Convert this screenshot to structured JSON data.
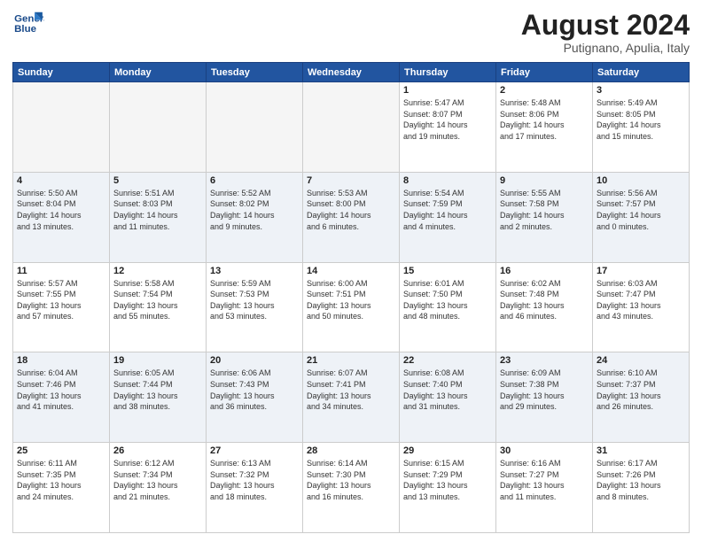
{
  "header": {
    "logo_line1": "General",
    "logo_line2": "Blue",
    "month": "August 2024",
    "location": "Putignano, Apulia, Italy"
  },
  "weekdays": [
    "Sunday",
    "Monday",
    "Tuesday",
    "Wednesday",
    "Thursday",
    "Friday",
    "Saturday"
  ],
  "weeks": [
    [
      {
        "day": "",
        "empty": true
      },
      {
        "day": "",
        "empty": true
      },
      {
        "day": "",
        "empty": true
      },
      {
        "day": "",
        "empty": true
      },
      {
        "day": "1",
        "info": "Sunrise: 5:47 AM\nSunset: 8:07 PM\nDaylight: 14 hours\nand 19 minutes."
      },
      {
        "day": "2",
        "info": "Sunrise: 5:48 AM\nSunset: 8:06 PM\nDaylight: 14 hours\nand 17 minutes."
      },
      {
        "day": "3",
        "info": "Sunrise: 5:49 AM\nSunset: 8:05 PM\nDaylight: 14 hours\nand 15 minutes."
      }
    ],
    [
      {
        "day": "4",
        "info": "Sunrise: 5:50 AM\nSunset: 8:04 PM\nDaylight: 14 hours\nand 13 minutes."
      },
      {
        "day": "5",
        "info": "Sunrise: 5:51 AM\nSunset: 8:03 PM\nDaylight: 14 hours\nand 11 minutes."
      },
      {
        "day": "6",
        "info": "Sunrise: 5:52 AM\nSunset: 8:02 PM\nDaylight: 14 hours\nand 9 minutes."
      },
      {
        "day": "7",
        "info": "Sunrise: 5:53 AM\nSunset: 8:00 PM\nDaylight: 14 hours\nand 6 minutes."
      },
      {
        "day": "8",
        "info": "Sunrise: 5:54 AM\nSunset: 7:59 PM\nDaylight: 14 hours\nand 4 minutes."
      },
      {
        "day": "9",
        "info": "Sunrise: 5:55 AM\nSunset: 7:58 PM\nDaylight: 14 hours\nand 2 minutes."
      },
      {
        "day": "10",
        "info": "Sunrise: 5:56 AM\nSunset: 7:57 PM\nDaylight: 14 hours\nand 0 minutes."
      }
    ],
    [
      {
        "day": "11",
        "info": "Sunrise: 5:57 AM\nSunset: 7:55 PM\nDaylight: 13 hours\nand 57 minutes."
      },
      {
        "day": "12",
        "info": "Sunrise: 5:58 AM\nSunset: 7:54 PM\nDaylight: 13 hours\nand 55 minutes."
      },
      {
        "day": "13",
        "info": "Sunrise: 5:59 AM\nSunset: 7:53 PM\nDaylight: 13 hours\nand 53 minutes."
      },
      {
        "day": "14",
        "info": "Sunrise: 6:00 AM\nSunset: 7:51 PM\nDaylight: 13 hours\nand 50 minutes."
      },
      {
        "day": "15",
        "info": "Sunrise: 6:01 AM\nSunset: 7:50 PM\nDaylight: 13 hours\nand 48 minutes."
      },
      {
        "day": "16",
        "info": "Sunrise: 6:02 AM\nSunset: 7:48 PM\nDaylight: 13 hours\nand 46 minutes."
      },
      {
        "day": "17",
        "info": "Sunrise: 6:03 AM\nSunset: 7:47 PM\nDaylight: 13 hours\nand 43 minutes."
      }
    ],
    [
      {
        "day": "18",
        "info": "Sunrise: 6:04 AM\nSunset: 7:46 PM\nDaylight: 13 hours\nand 41 minutes."
      },
      {
        "day": "19",
        "info": "Sunrise: 6:05 AM\nSunset: 7:44 PM\nDaylight: 13 hours\nand 38 minutes."
      },
      {
        "day": "20",
        "info": "Sunrise: 6:06 AM\nSunset: 7:43 PM\nDaylight: 13 hours\nand 36 minutes."
      },
      {
        "day": "21",
        "info": "Sunrise: 6:07 AM\nSunset: 7:41 PM\nDaylight: 13 hours\nand 34 minutes."
      },
      {
        "day": "22",
        "info": "Sunrise: 6:08 AM\nSunset: 7:40 PM\nDaylight: 13 hours\nand 31 minutes."
      },
      {
        "day": "23",
        "info": "Sunrise: 6:09 AM\nSunset: 7:38 PM\nDaylight: 13 hours\nand 29 minutes."
      },
      {
        "day": "24",
        "info": "Sunrise: 6:10 AM\nSunset: 7:37 PM\nDaylight: 13 hours\nand 26 minutes."
      }
    ],
    [
      {
        "day": "25",
        "info": "Sunrise: 6:11 AM\nSunset: 7:35 PM\nDaylight: 13 hours\nand 24 minutes."
      },
      {
        "day": "26",
        "info": "Sunrise: 6:12 AM\nSunset: 7:34 PM\nDaylight: 13 hours\nand 21 minutes."
      },
      {
        "day": "27",
        "info": "Sunrise: 6:13 AM\nSunset: 7:32 PM\nDaylight: 13 hours\nand 18 minutes."
      },
      {
        "day": "28",
        "info": "Sunrise: 6:14 AM\nSunset: 7:30 PM\nDaylight: 13 hours\nand 16 minutes."
      },
      {
        "day": "29",
        "info": "Sunrise: 6:15 AM\nSunset: 7:29 PM\nDaylight: 13 hours\nand 13 minutes."
      },
      {
        "day": "30",
        "info": "Sunrise: 6:16 AM\nSunset: 7:27 PM\nDaylight: 13 hours\nand 11 minutes."
      },
      {
        "day": "31",
        "info": "Sunrise: 6:17 AM\nSunset: 7:26 PM\nDaylight: 13 hours\nand 8 minutes."
      }
    ]
  ]
}
